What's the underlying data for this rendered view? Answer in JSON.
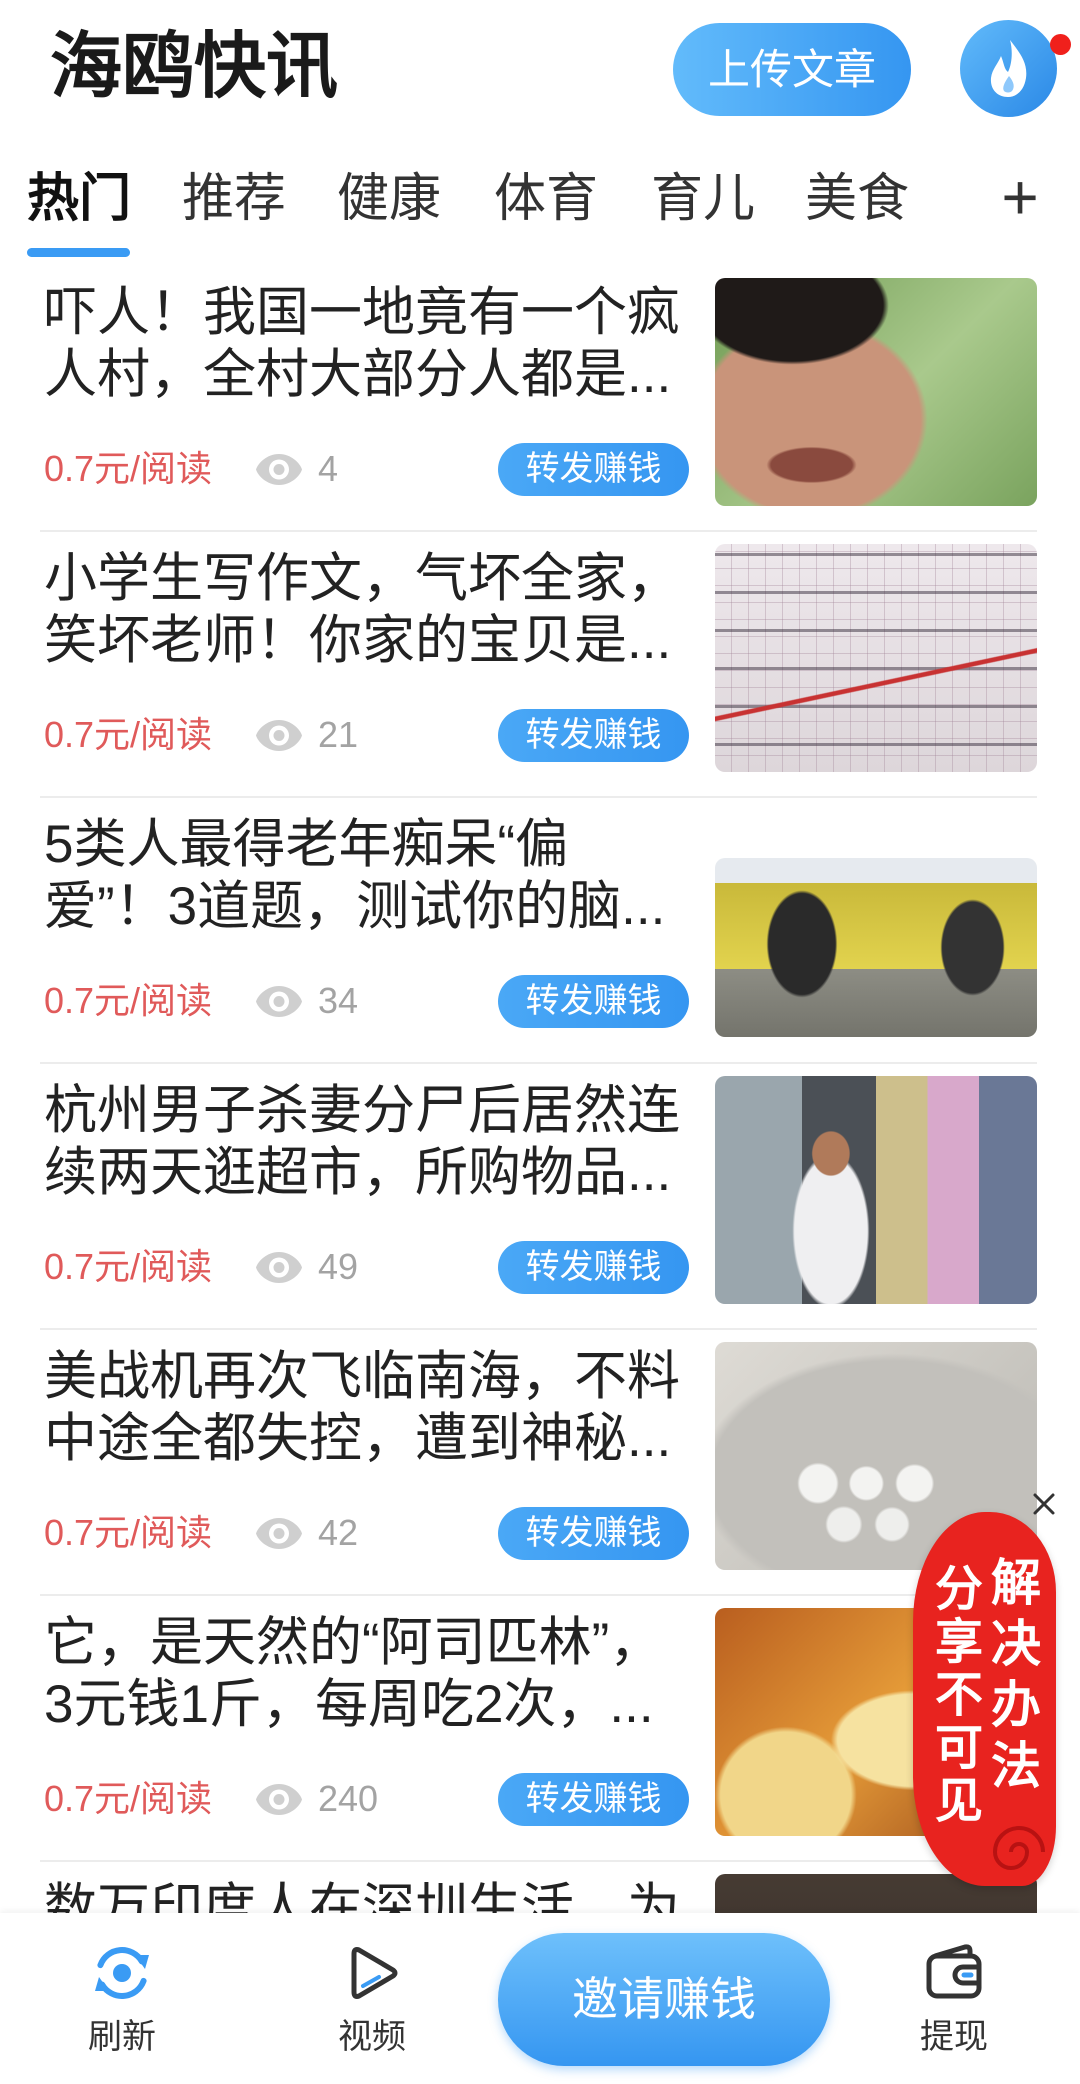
{
  "header": {
    "app_title": "海鸥快讯",
    "upload_label": "上传文章"
  },
  "tabs": [
    {
      "label": "热门",
      "active": true
    },
    {
      "label": "推荐",
      "active": false
    },
    {
      "label": "健康",
      "active": false
    },
    {
      "label": "体育",
      "active": false
    },
    {
      "label": "育儿",
      "active": false
    },
    {
      "label": "美食",
      "active": false
    }
  ],
  "tabs_more": "+",
  "articles": [
    {
      "title_line1": "吓人！我国一地竟有一个疯",
      "title_line2": "人村，全村大部分人都是...",
      "price": "0.7元/阅读",
      "views": "4",
      "share_label": "转发赚钱"
    },
    {
      "title_line1": "小学生写作文，气坏全家，",
      "title_line2": "笑坏老师！你家的宝贝是...",
      "price": "0.7元/阅读",
      "views": "21",
      "share_label": "转发赚钱"
    },
    {
      "title_line1": "5类人最得老年痴呆“偏",
      "title_line2": "爱”！3道题，测试你的脑...",
      "price": "0.7元/阅读",
      "views": "34",
      "share_label": "转发赚钱"
    },
    {
      "title_line1": "杭州男子杀妻分尸后居然连",
      "title_line2": "续两天逛超市，所购物品...",
      "price": "0.7元/阅读",
      "views": "49",
      "share_label": "转发赚钱"
    },
    {
      "title_line1": "美战机再次飞临南海，不料",
      "title_line2": "中途全都失控，遭到神秘...",
      "price": "0.7元/阅读",
      "views": "42",
      "share_label": "转发赚钱"
    },
    {
      "title_line1": "它，是天然的“阿司匹林”，",
      "title_line2": "3元钱1斤，每周吃2次，...",
      "price": "0.7元/阅读",
      "views": "240",
      "share_label": "转发赚钱"
    },
    {
      "title_line1": "数万印度人在深圳生活，为"
    }
  ],
  "float_badge": {
    "text_left": "分享不可见",
    "text_right": "解决办法"
  },
  "bottom_nav": {
    "refresh_label": "刷新",
    "video_label": "视频",
    "invite_label": "邀请赚钱",
    "withdraw_label": "提现"
  },
  "colors": {
    "accent": "#3a9bf4",
    "price": "#e05a5a",
    "badge": "#e8231f",
    "notification_dot": "#f0201c"
  },
  "icons": {
    "avatar": "flame-icon",
    "views": "eye-icon",
    "refresh": "refresh-icon",
    "video": "video-play-icon",
    "withdraw": "wallet-icon",
    "badge_close": "close-icon"
  }
}
